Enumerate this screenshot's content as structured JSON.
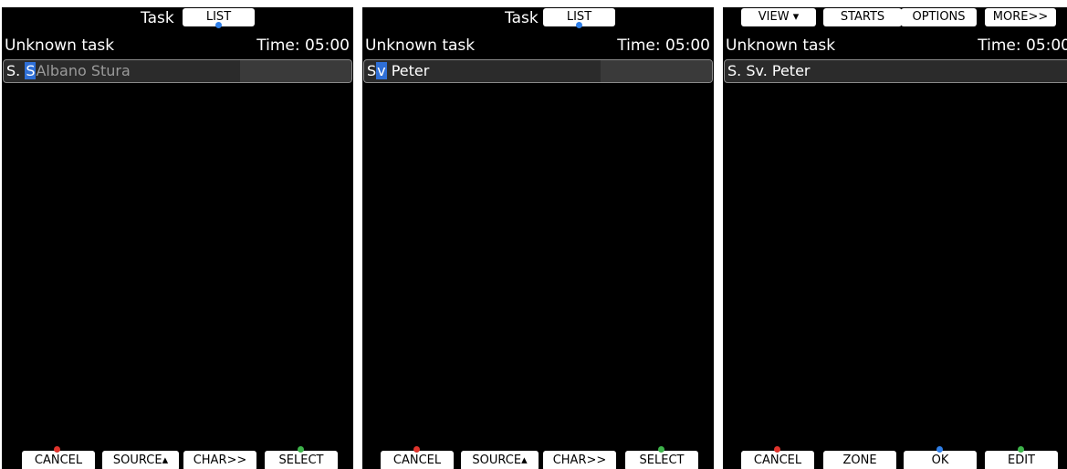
{
  "screens": [
    {
      "title": "Task",
      "top_button": "LIST",
      "task_name": "Unknown task",
      "time_label": "Time: 05:00",
      "search": {
        "before": "S. ",
        "cursor": "S",
        "hint": "Albano Stura"
      },
      "buttons": [
        "CANCEL",
        "SOURCE▴",
        "CHAR>>",
        "SELECT"
      ]
    },
    {
      "title": "Task",
      "top_button": "LIST",
      "task_name": "Unknown task",
      "time_label": "Time: 05:00",
      "search": {
        "before": "S",
        "cursor": "v",
        "after": " Peter"
      },
      "buttons": [
        "CANCEL",
        "SOURCE▴",
        "CHAR>>",
        "SELECT"
      ]
    },
    {
      "top_menu": [
        "VIEW ▾",
        "STARTS",
        "OPTIONS",
        "MORE>>"
      ],
      "task_name": "Unknown task",
      "time_label": "Time: 05:00",
      "selected_item": "S. Sv. Peter",
      "buttons": [
        "CANCEL",
        "ZONE",
        "OK",
        "EDIT"
      ]
    }
  ],
  "colors": {
    "cursor": "#2f6fd6",
    "cancel_dot": "#e0342c",
    "select_dot": "#3db34a",
    "info_dot": "#2f7fe8"
  }
}
